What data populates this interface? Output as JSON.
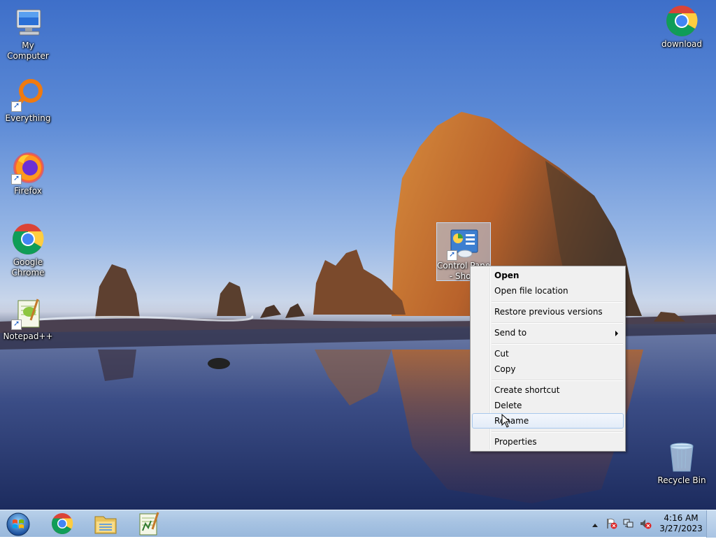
{
  "desktop": {
    "icons_left": [
      {
        "label": "My Computer",
        "icon": "my-computer-icon"
      },
      {
        "label": "Everything",
        "icon": "everything-icon"
      },
      {
        "label": "Firefox",
        "icon": "firefox-icon"
      },
      {
        "label": "Google Chrome",
        "icon": "chrome-icon"
      },
      {
        "label": "Notepad++",
        "icon": "notepadpp-icon"
      }
    ],
    "icons_right": [
      {
        "label": "download",
        "icon": "chrome-icon"
      },
      {
        "label": "Recycle Bin",
        "icon": "recycle-bin-icon"
      }
    ],
    "selected_icon": {
      "label_line1": "Control Panel",
      "label_line2": "- Short",
      "icon": "control-panel-icon"
    }
  },
  "context_menu": {
    "items": [
      {
        "label": "Open",
        "bold": true
      },
      {
        "label": "Open file location"
      },
      {
        "label": "Restore previous versions"
      },
      {
        "label": "Send to",
        "submenu": true
      },
      {
        "label": "Cut"
      },
      {
        "label": "Copy"
      },
      {
        "label": "Create shortcut"
      },
      {
        "label": "Delete"
      },
      {
        "label": "Rename",
        "highlighted": true
      },
      {
        "label": "Properties"
      }
    ]
  },
  "taskbar": {
    "pinned": [
      "start-orb-icon",
      "chrome-icon",
      "file-explorer-icon",
      "notepadpp-icon"
    ],
    "tray_icons": [
      "show-hidden-icon",
      "action-center-flag-icon",
      "network-icon",
      "volume-muted-icon"
    ],
    "clock": {
      "time": "4:16 AM",
      "date": "3/27/2023"
    }
  },
  "colors": {
    "menu_bg": "#f0f0f0",
    "menu_highlight_border": "#a8c8ec",
    "taskbar": "#a7c3e2"
  }
}
